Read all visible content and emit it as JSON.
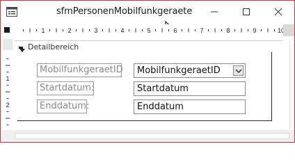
{
  "window": {
    "title": "sfmPersonenMobilfunkgeraete",
    "controls": [
      "minimize",
      "maximize",
      "close"
    ]
  },
  "ruler": {
    "horizontal_numbers": [
      "1",
      "2",
      "3",
      "4",
      "5",
      "6",
      "7",
      "8",
      "9",
      "10"
    ],
    "vertical_numbers": [
      "1",
      "2"
    ]
  },
  "section": {
    "label": "Detailbereich",
    "icon": "down-arrow-icon"
  },
  "form": {
    "fields": [
      {
        "label": "MobilfunkgeraetID",
        "value": "MobilfunkgeraetID",
        "control": "combobox"
      },
      {
        "label": "Startdatum:",
        "value": "Startdatum",
        "control": "textbox"
      },
      {
        "label": "Enddatum:",
        "value": "Enddatum",
        "control": "textbox"
      }
    ]
  },
  "colors": {
    "window_border": "#c13b43",
    "label_text": "#8a8a8a",
    "field_text": "#111111"
  }
}
